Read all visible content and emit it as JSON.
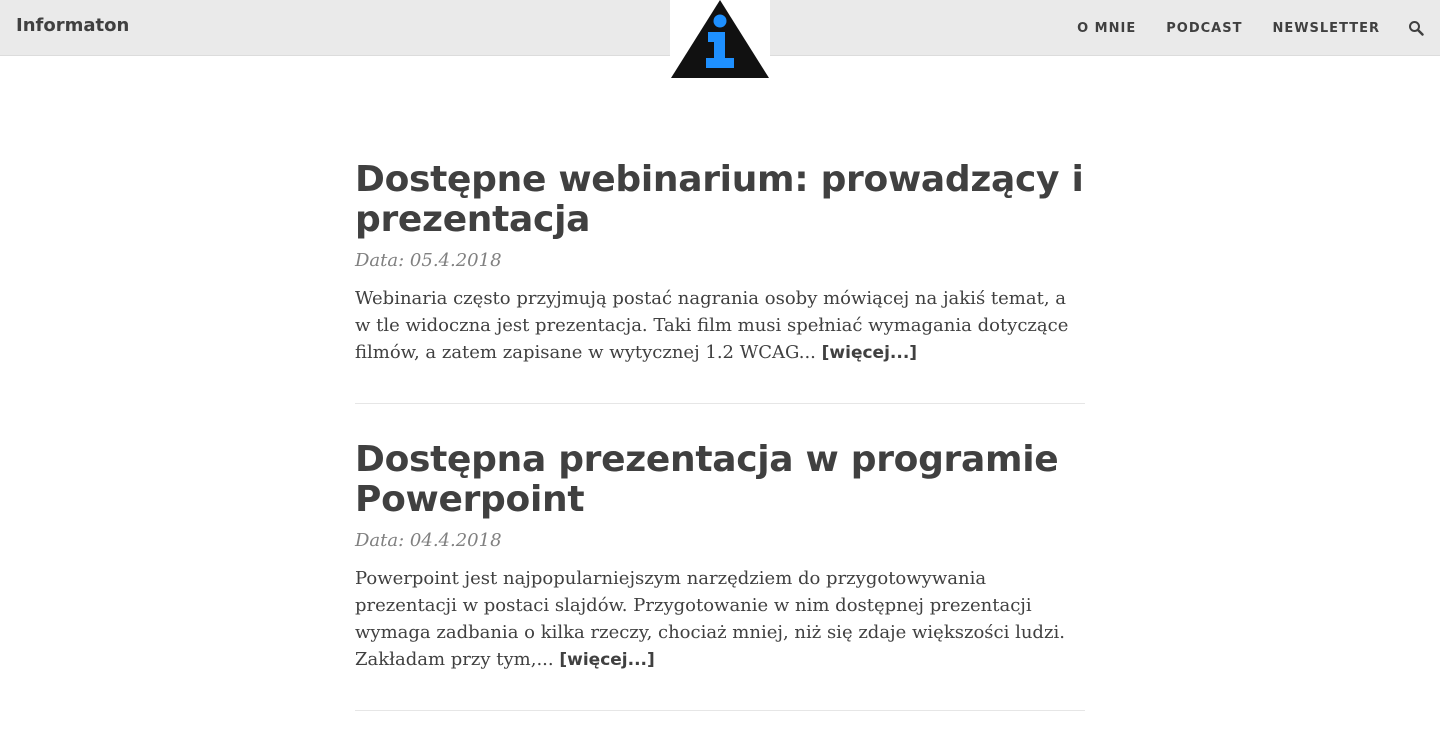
{
  "navbar": {
    "brand": "Informaton",
    "links": [
      "O MNIE",
      "PODCAST",
      "NEWSLETTER"
    ],
    "search_icon": "search-icon",
    "logo_icon": "info-triangle-icon",
    "colors": {
      "background": "#eaeaea",
      "logo_black": "#111111",
      "logo_blue": "#1e90ff"
    }
  },
  "posts": [
    {
      "title": "Dostępne webinarium: prowadzący i prezentacja",
      "meta": "Data: 05.4.2018",
      "excerpt": "Webinaria często przyjmują postać nagrania osoby mówiącej na jakiś temat, a w tle widoczna jest prezentacja. Taki film musi spełniać wymagania dotyczące filmów, a zatem zapisane w wytycznej 1.2 WCAG...",
      "more": "[więcej...]"
    },
    {
      "title": "Dostępna prezentacja w programie Powerpoint",
      "meta": "Data: 04.4.2018",
      "excerpt": "Powerpoint jest najpopularniejszym narzędziem do przygotowywania prezentacji w postaci slajdów. Przygotowanie w nim dostępnej prezentacji wymaga zadbania o kilka rzeczy, chociaż mniej, niż się zdaje większości ludzi. Zakładam przy tym,...",
      "more": "[więcej...]"
    }
  ]
}
